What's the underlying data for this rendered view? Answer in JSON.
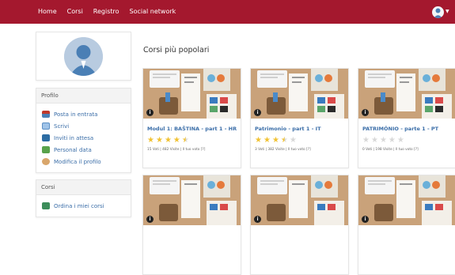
{
  "nav": {
    "items": [
      "Home",
      "Corsi",
      "Registro",
      "Social network"
    ]
  },
  "sidebar": {
    "profile_section": {
      "title": "Profilo",
      "items": [
        {
          "label": "Posta in entrata",
          "icon": "inbox-icon"
        },
        {
          "label": "Scrivi",
          "icon": "compose-icon"
        },
        {
          "label": "Inviti in attesa",
          "icon": "invites-icon"
        },
        {
          "label": "Personal data",
          "icon": "personal-data-icon"
        },
        {
          "label": "Modifica il profilo",
          "icon": "edit-profile-icon"
        }
      ]
    },
    "courses_section": {
      "title": "Corsi",
      "items": [
        {
          "label": "Ordina i miei corsi",
          "icon": "sort-courses-icon"
        }
      ]
    }
  },
  "main": {
    "title": "Corsi più popolari",
    "cards": [
      {
        "title": "Modul 1: BAŠTINA - part 1 - HR",
        "rating": 4.5,
        "meta": "15 Voti | 482 Visite | Il tuo voto [?]"
      },
      {
        "title": "Patrimonio - part 1 - IT",
        "rating": 3.5,
        "meta": "3 Voti | 382 Visite | Il tuo voto [?]"
      },
      {
        "title": "PATRIMÓNIO - parte 1 - PT",
        "rating": 0,
        "meta": "0 Voti | 198 Visite | Il tuo voto [?]"
      },
      {
        "title": "",
        "rating": null,
        "meta": ""
      },
      {
        "title": "",
        "rating": null,
        "meta": ""
      },
      {
        "title": "",
        "rating": null,
        "meta": ""
      }
    ]
  },
  "colors": {
    "brand": "#a4182e",
    "link": "#3b6ea8",
    "star": "#f1c232"
  }
}
